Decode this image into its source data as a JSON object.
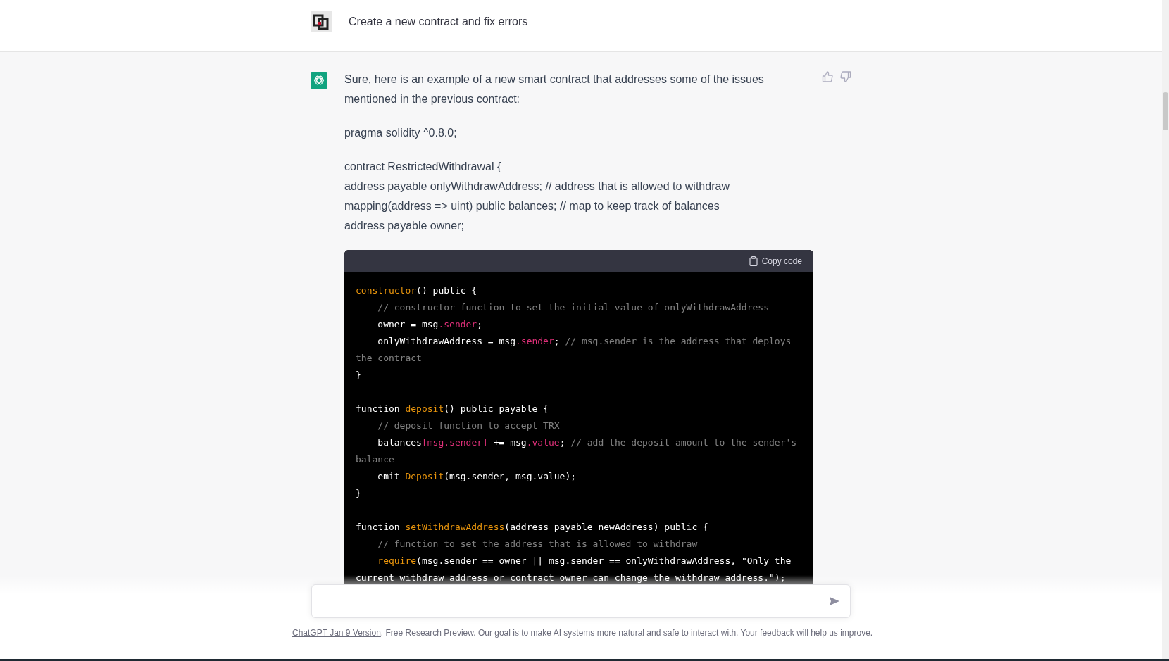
{
  "user_message": {
    "text": "Create a new contract and fix errors"
  },
  "assistant_message": {
    "paragraphs": [
      [
        "Sure, here is an example of a new smart contract that addresses some of the issues mentioned in the previous contract:"
      ],
      [
        "pragma solidity ^0.8.0;"
      ],
      [
        "contract RestrictedWithdrawal {",
        "address payable onlyWithdrawAddress; // address that is allowed to withdraw",
        "mapping(address => uint) public balances; // map to keep track of balances",
        "address payable owner;"
      ]
    ],
    "code_block": {
      "copy_label": "Copy code",
      "blocks": [
        [
          [
            {
              "kind": "function",
              "text": "constructor"
            },
            {
              "kind": "plain",
              "text": "() public {"
            }
          ],
          [
            {
              "kind": "comment",
              "text": "    // constructor function to set the initial value of onlyWithdrawAddress"
            }
          ],
          [
            {
              "kind": "plain",
              "text": "    owner = msg"
            },
            {
              "kind": "property",
              "text": ".sender"
            },
            {
              "kind": "plain",
              "text": ";"
            }
          ],
          [
            {
              "kind": "plain",
              "text": "    onlyWithdrawAddress = msg"
            },
            {
              "kind": "property",
              "text": ".sender"
            },
            {
              "kind": "plain",
              "text": "; "
            },
            {
              "kind": "comment",
              "text": "// msg.sender is the address that deploys the contract"
            }
          ],
          [
            {
              "kind": "plain",
              "text": "}"
            }
          ]
        ],
        [
          [
            {
              "kind": "plain",
              "text": "function "
            },
            {
              "kind": "function",
              "text": "deposit"
            },
            {
              "kind": "plain",
              "text": "() public payable {"
            }
          ],
          [
            {
              "kind": "comment",
              "text": "    // deposit function to accept TRX"
            }
          ],
          [
            {
              "kind": "plain",
              "text": "    balances"
            },
            {
              "kind": "property",
              "text": "[msg.sender]"
            },
            {
              "kind": "plain",
              "text": " += msg"
            },
            {
              "kind": "property",
              "text": ".value"
            },
            {
              "kind": "plain",
              "text": "; "
            },
            {
              "kind": "comment",
              "text": "// add the deposit amount to the sender's balance"
            }
          ],
          [
            {
              "kind": "plain",
              "text": "    emit "
            },
            {
              "kind": "function",
              "text": "Deposit"
            },
            {
              "kind": "plain",
              "text": "(msg.sender, msg.value);"
            }
          ],
          [
            {
              "kind": "plain",
              "text": "}"
            }
          ]
        ],
        [
          [
            {
              "kind": "plain",
              "text": "function "
            },
            {
              "kind": "function",
              "text": "setWithdrawAddress"
            },
            {
              "kind": "plain",
              "text": "(address payable newAddress) public {"
            }
          ],
          [
            {
              "kind": "comment",
              "text": "    // function to set the address that is allowed to withdraw"
            }
          ],
          [
            {
              "kind": "function",
              "text": "    require"
            },
            {
              "kind": "plain",
              "text": "(msg.sender == owner || msg.sender == onlyWithdrawAddress, \"Only the current withdraw address or contract owner can change the withdraw address.\");"
            }
          ]
        ]
      ]
    }
  },
  "footer": {
    "link": "ChatGPT Jan 9 Version",
    "text": ". Free Research Preview. Our goal is to make AI systems more natural and safe to interact with. Your feedback will help us improve."
  }
}
